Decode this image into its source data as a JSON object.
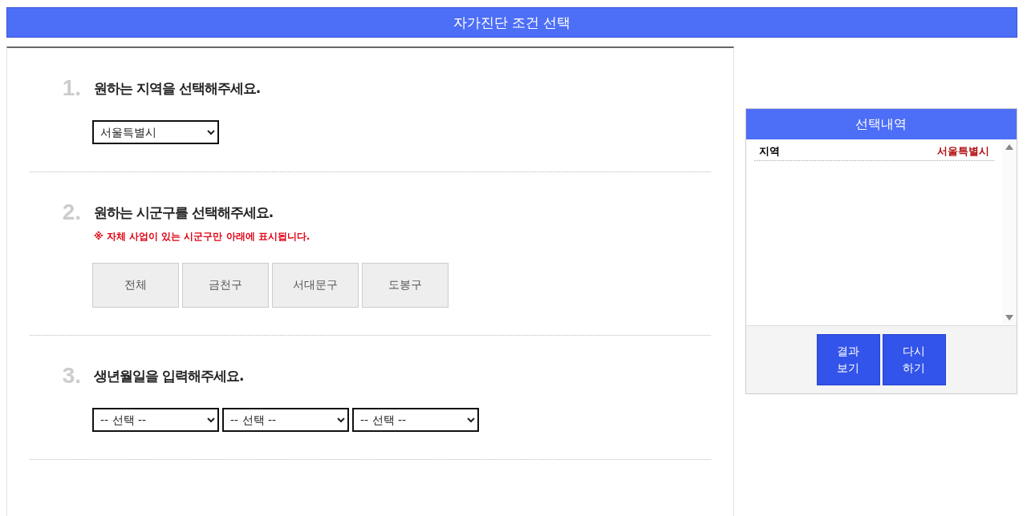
{
  "header": {
    "title": "자가진단 조건 선택"
  },
  "steps": [
    {
      "number": "1.",
      "title": "원하는 지역을 선택해주세요.",
      "kind": "select",
      "selects": [
        "서울특별시"
      ]
    },
    {
      "number": "2.",
      "title": "원하는 시군구를 선택해주세요.",
      "note": "※ 자체 사업이 있는 시군구만 아래에 표시됩니다.",
      "kind": "buttons",
      "options": [
        {
          "label": "전체",
          "selected": false
        },
        {
          "label": "금천구",
          "selected": false
        },
        {
          "label": "서대문구",
          "selected": false
        },
        {
          "label": "도봉구",
          "selected": false
        }
      ]
    },
    {
      "number": "3.",
      "title": "생년월일을 입력해주세요.",
      "kind": "select",
      "selects": [
        "-- 선택 --",
        "-- 선택 --",
        "-- 선택 --"
      ]
    }
  ],
  "summary": {
    "title": "선택내역",
    "rows": [
      {
        "label": "지역",
        "value": "서울특별시"
      }
    ],
    "buttons": [
      "결과 보기",
      "다시 하기"
    ]
  }
}
